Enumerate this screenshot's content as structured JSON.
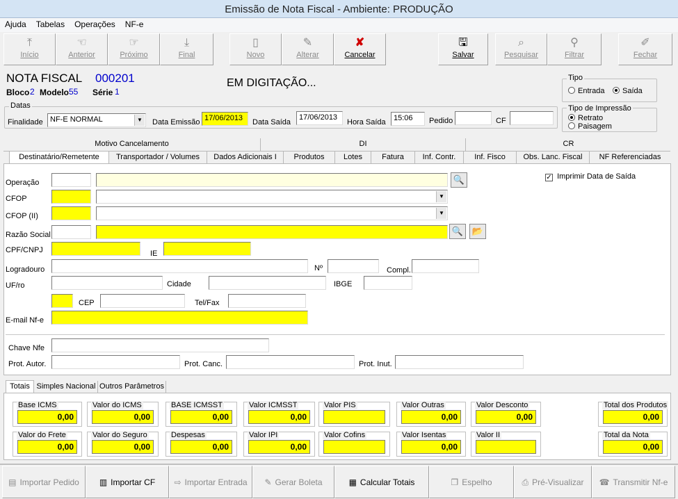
{
  "window": {
    "title": "Emissão de Nota Fiscal - Ambiente: PRODUÇÃO"
  },
  "menu": [
    "Ajuda",
    "Tabelas",
    "Operações",
    "NF-e"
  ],
  "toolbar": {
    "inicio": "Início",
    "anterior": "Anterior",
    "proximo": "Próximo",
    "final": "Final",
    "novo": "Novo",
    "alterar": "Alterar",
    "cancelar": "Cancelar",
    "salvar": "Salvar",
    "pesquisar": "Pesquisar",
    "filtrar": "Filtrar",
    "fechar": "Fechar"
  },
  "header": {
    "nota_label": "NOTA FISCAL",
    "nota_number": "000201",
    "bloco_label": "Bloco",
    "bloco_value": "2",
    "modelo_label": "Modelo",
    "modelo_value": "55",
    "serie_label": "Série",
    "serie_value": "1",
    "status": "EM DIGITAÇÃO..."
  },
  "tipo": {
    "title": "Tipo",
    "entrada": "Entrada",
    "saida": "Saída",
    "selected": "saida"
  },
  "impressao": {
    "title": "Tipo de Impressão",
    "retrato": "Retrato",
    "paisagem": "Paisagem",
    "selected": "retrato"
  },
  "datas": {
    "title": "Datas",
    "finalidade_label": "Finalidade",
    "finalidade_value": "NF-E NORMAL",
    "emissao_label": "Data Emissão",
    "emissao_value": "17/06/2013",
    "saida_label": "Data Saída",
    "saida_value": "17/06/2013",
    "hora_label": "Hora Saída",
    "hora_value": "15:06",
    "pedido_label": "Pedido",
    "pedido_value": "",
    "cf_label": "CF",
    "cf_value": ""
  },
  "tabs_top": [
    "Motivo Cancelamento",
    "DI",
    "CR"
  ],
  "tabs": [
    "Destinatário/Remetente",
    "Transportador / Volumes",
    "Dados Adicionais I",
    "Produtos",
    "Lotes",
    "Fatura",
    "Inf. Contr.",
    "Inf. Fisco",
    "Obs. Lanc. Fiscal",
    "NF Referenciadas"
  ],
  "form": {
    "operacao": "Operação",
    "cfop": "CFOP",
    "cfop2": "CFOP (II)",
    "razao": "Razão Social",
    "cpf": "CPF/CNPJ",
    "ie": "IE",
    "logradouro": "Logradouro",
    "numero": "Nº",
    "compl": "Compl.",
    "uf": "UF/ro",
    "cidade": "Cidade",
    "ibge": "IBGE",
    "cep": "CEP",
    "tel": "Tel/Fax",
    "email": "E-mail Nf-e",
    "chave": "Chave Nfe",
    "prot_autor": "Prot. Autor.",
    "prot_canc": "Prot. Canc.",
    "prot_inut": "Prot. Inut.",
    "imprimir_data": "Imprimir Data de Saída",
    "imprimir_checked": true
  },
  "subtabs": [
    "Totais",
    "Simples Nacional",
    "Outros Parâmetros"
  ],
  "totais": [
    {
      "label": "Base ICMS",
      "value": "0,00"
    },
    {
      "label": "Valor do ICMS",
      "value": "0,00"
    },
    {
      "label": "BASE ICMSST",
      "value": "0,00"
    },
    {
      "label": "Valor ICMSST",
      "value": "0,00"
    },
    {
      "label": "Valor PIS",
      "value": ""
    },
    {
      "label": "Valor Outras",
      "value": "0,00"
    },
    {
      "label": "Valor Desconto",
      "value": "0,00"
    },
    {
      "label": "Total dos Produtos",
      "value": "0,00"
    },
    {
      "label": "Valor do Frete",
      "value": "0,00"
    },
    {
      "label": "Valor do Seguro",
      "value": "0,00"
    },
    {
      "label": "Despesas",
      "value": "0,00"
    },
    {
      "label": "Valor IPI",
      "value": "0,00"
    },
    {
      "label": "Valor Cofins",
      "value": ""
    },
    {
      "label": "Valor Isentas",
      "value": "0,00"
    },
    {
      "label": "Valor II",
      "value": ""
    },
    {
      "label": "Total da Nota",
      "value": "0,00"
    }
  ],
  "bottom": {
    "importar_pedido": "Importar Pedido",
    "importar_cf": "Importar CF",
    "importar_entrada": "Importar Entrada",
    "gerar_boleta": "Gerar Boleta",
    "calcular": "Calcular Totais",
    "espelho": "Espelho",
    "pre_visualizar": "Pré-Visualizar",
    "transmitir": "Transmitir Nf-e"
  },
  "colors": {
    "required": "#ffff00",
    "light": "#ffffe0",
    "accent": "#0000cc"
  }
}
